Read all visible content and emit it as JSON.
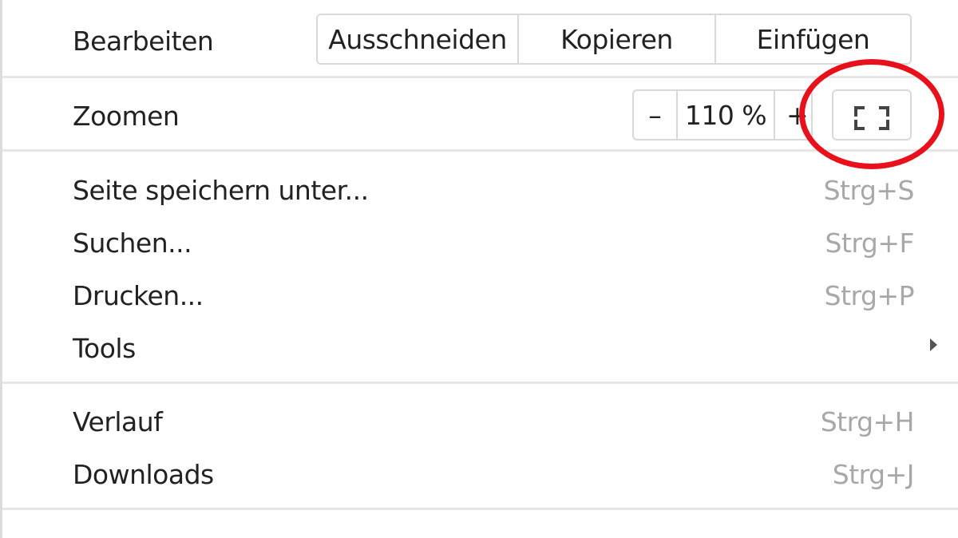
{
  "menu": {
    "edit": {
      "label": "Bearbeiten",
      "cut": "Ausschneiden",
      "copy": "Kopieren",
      "paste": "Einfügen"
    },
    "zoom": {
      "label": "Zoomen",
      "minus": "–",
      "value": "110 %",
      "plus": "+",
      "fullscreen_icon": "fullscreen-icon"
    },
    "items_group1": [
      {
        "label": "Seite speichern unter...",
        "shortcut": "Strg+S"
      },
      {
        "label": "Suchen...",
        "shortcut": "Strg+F"
      },
      {
        "label": "Drucken...",
        "shortcut": "Strg+P"
      },
      {
        "label": "Tools",
        "shortcut": ""
      }
    ],
    "items_group2": [
      {
        "label": "Verlauf",
        "shortcut": "Strg+H"
      },
      {
        "label": "Downloads",
        "shortcut": "Strg+J"
      }
    ]
  },
  "annotation": {
    "color": "#e8101a",
    "shape": "circle-highlight"
  }
}
